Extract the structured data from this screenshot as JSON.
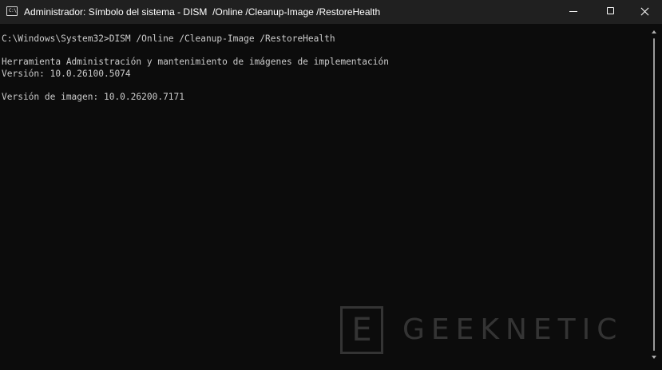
{
  "window": {
    "title": "Administrador: Símbolo del sistema - DISM  /Online /Cleanup-Image /RestoreHealth",
    "icon": "command-prompt-icon",
    "icon_glyph": "C:\\",
    "buttons": {
      "minimize": "minimize-icon",
      "maximize": "maximize-icon",
      "close": "close-icon"
    }
  },
  "console": {
    "lines": [
      "C:\\Windows\\System32>DISM /Online /Cleanup-Image /RestoreHealth",
      "Herramienta Administración y mantenimiento de imágenes de implementación",
      "Versión: 10.0.26100.5074",
      "Versión de imagen: 10.0.26200.7171"
    ],
    "text_color": "#cccccc",
    "background": "#0c0c0c"
  },
  "watermark": {
    "box_letter": "E",
    "text": "GEEKNETIC"
  }
}
